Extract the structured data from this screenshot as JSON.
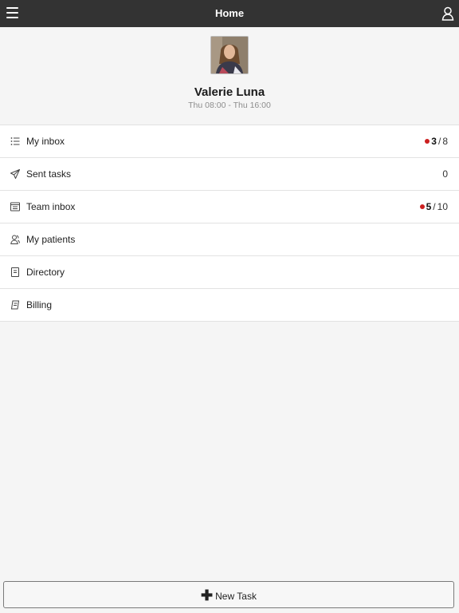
{
  "header": {
    "title": "Home",
    "menu_icon": "hamburger-menu-icon",
    "user_icon": "user-icon"
  },
  "profile": {
    "name": "Valerie Luna",
    "hours": "Thu 08:00 - Thu 16:00"
  },
  "menu": [
    {
      "label": "My inbox",
      "icon": "list-icon",
      "unread": "3",
      "separator": "/",
      "total": "8"
    },
    {
      "label": "Sent tasks",
      "icon": "paper-plane-icon",
      "count": "0"
    },
    {
      "label": "Team inbox",
      "icon": "team-inbox-icon",
      "unread": "5",
      "separator": "/",
      "total": "10"
    },
    {
      "label": "My patients",
      "icon": "patients-icon"
    },
    {
      "label": "Directory",
      "icon": "directory-icon"
    },
    {
      "label": "Billing",
      "icon": "billing-icon"
    }
  ],
  "footer": {
    "new_task_label": "New Task",
    "new_task_icon": "plus-icon"
  },
  "colors": {
    "topbar": "#333333",
    "unread_dot": "#cc2020",
    "background": "#f5f5f5"
  }
}
